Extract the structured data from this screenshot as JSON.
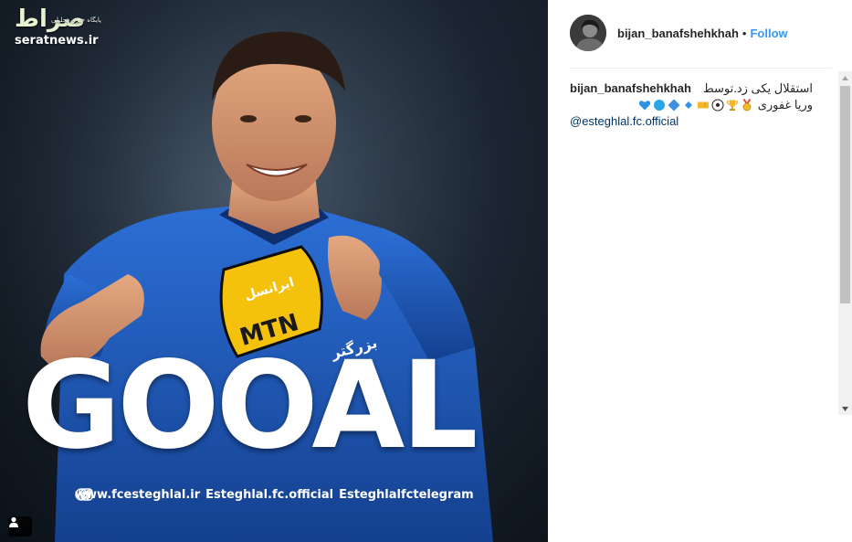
{
  "watermark": {
    "logo_text": "صراط",
    "tagline": "پایگاه خبری تحلیلی",
    "site": "seratnews.ir"
  },
  "media": {
    "headline": "GOOAL",
    "jersey_sponsor": "MTN",
    "jersey_text_top": "ایرانسل",
    "jersey_text_side": "بزرگتر",
    "social": {
      "website": "www.fcesteghlal.ir",
      "instagram": "Esteghlal.fc.official",
      "telegram": "Esteghlalfctelegram"
    },
    "icons": {
      "website": "globe-icon",
      "instagram": "instagram-icon",
      "telegram": "telegram-icon",
      "tag": "user-tag-icon"
    }
  },
  "post": {
    "username": "bijan_banafshehkhah",
    "separator": "•",
    "follow_label": "Follow",
    "follow_color": "#3897f0",
    "caption": {
      "username": "bijan_banafshehkhah",
      "text_rtl": "استقلال یکی زد.توسط",
      "author_rtl": "وریا غفوری",
      "emojis": [
        "blue-heart",
        "blue-circle",
        "large-blue-diamond",
        "small-blue-diamond",
        "ticket",
        "soccer-ball",
        "trophy",
        "sports-medal"
      ],
      "mention": "@esteghlal.fc.official"
    }
  },
  "colors": {
    "jersey_blue": "#1f5fc4",
    "sponsor_yellow": "#f4c20d",
    "link": "#003569"
  }
}
